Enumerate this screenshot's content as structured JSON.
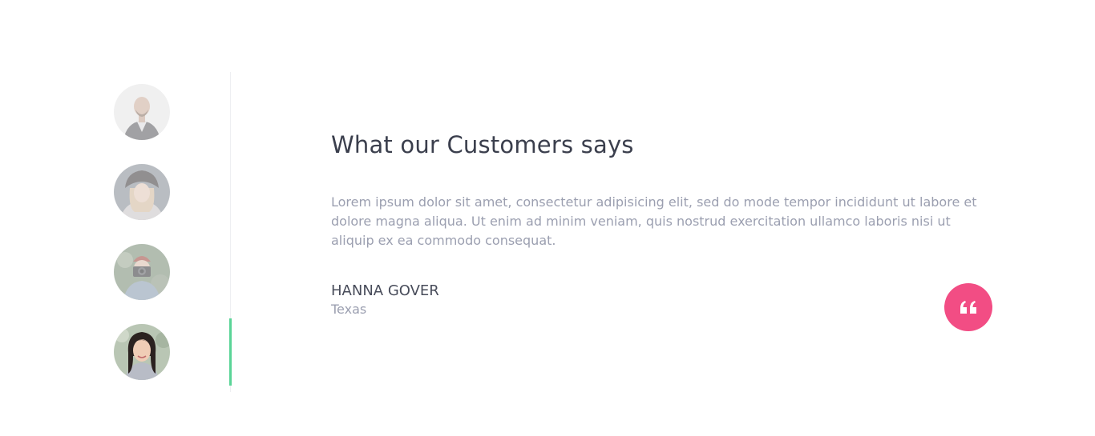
{
  "testimonials": {
    "title": "What our Customers says",
    "quote": "Lorem ipsum dolor sit amet, consectetur adipisicing elit, sed do mode tempor incididunt ut labore et dolore magna aliqua. Ut enim ad minim veniam, quis nostrud exercitation ullamco laboris nisi ut aliquip ex ea commodo consequat.",
    "author_name": "HANNA GOVER",
    "author_location": "Texas",
    "avatars": [
      {
        "icon": "bald-man-avatar",
        "active": false
      },
      {
        "icon": "woman-hat-avatar",
        "active": false
      },
      {
        "icon": "photographer-avatar",
        "active": false
      },
      {
        "icon": "asian-woman-avatar",
        "active": true
      }
    ],
    "quote_icon": "quote-icon",
    "colors": {
      "accent_active": "#5ad497",
      "quote_badge": "#f24d84",
      "title": "#3b3f4d",
      "body_text": "#9b9fb0"
    }
  }
}
